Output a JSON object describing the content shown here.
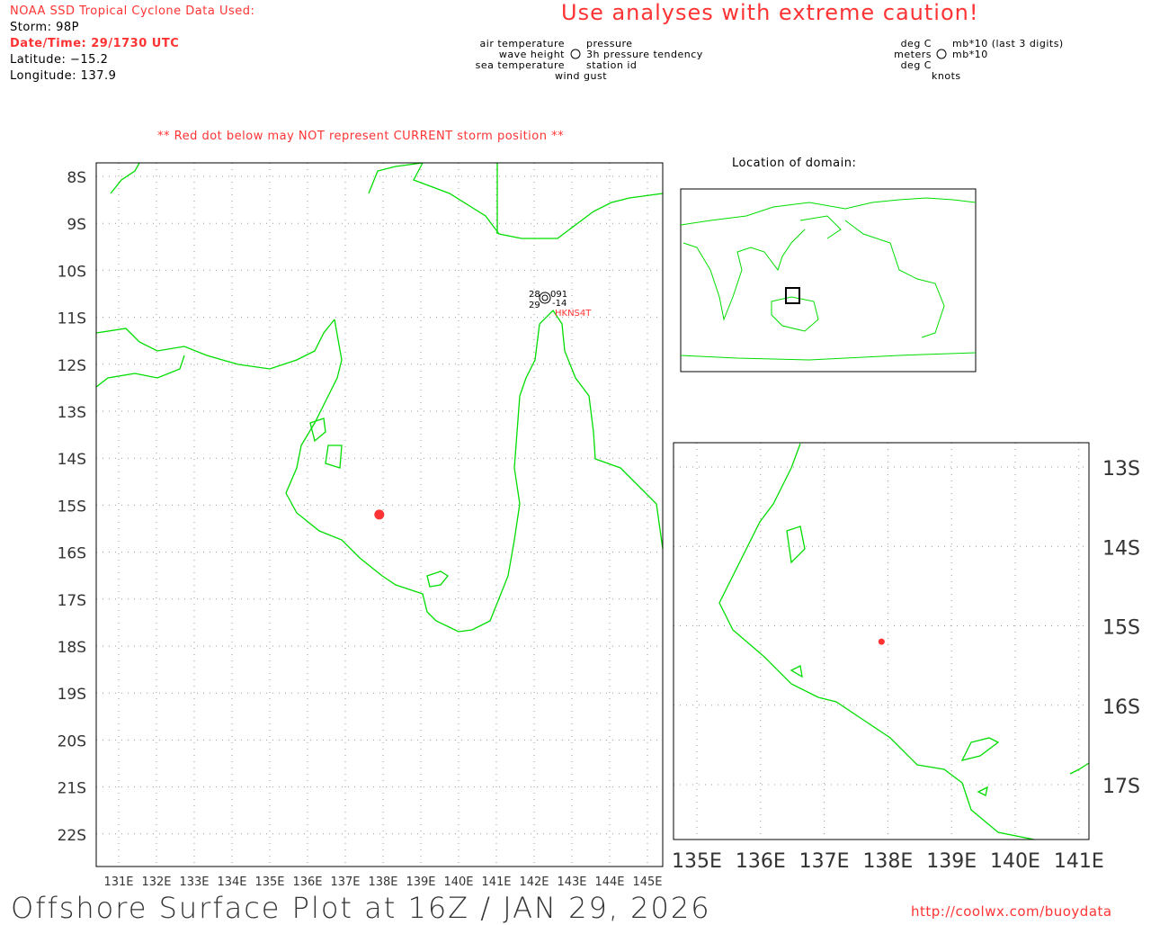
{
  "header": {
    "source_title": "NOAA SSD Tropical Cyclone Data Used:",
    "storm": "Storm: 98P",
    "datetime": "Date/Time: 29/1730 UTC",
    "latitude": "Latitude: −15.2",
    "longitude": "Longitude: 137.9",
    "caution": "Use  analyses  with  extreme  caution!",
    "warning": "** Red dot below may NOT represent CURRENT storm position **"
  },
  "legend": {
    "left": [
      "air temperature",
      "wave height",
      "sea temperature"
    ],
    "right": [
      "pressure",
      "3h pressure tendency",
      "station id"
    ],
    "bottom": "wind gust",
    "units_left": [
      "deg C",
      "meters",
      "deg C"
    ],
    "units_right": [
      "mb*10 (last 3 digits)",
      "mb*10"
    ],
    "units_bottom": "knots"
  },
  "main_map": {
    "lat_ticks": [
      "8S",
      "9S",
      "10S",
      "11S",
      "12S",
      "13S",
      "14S",
      "15S",
      "16S",
      "17S",
      "18S",
      "19S",
      "20S",
      "21S",
      "22S"
    ],
    "lon_ticks": [
      "131E",
      "132E",
      "133E",
      "134E",
      "135E",
      "136E",
      "137E",
      "138E",
      "139E",
      "140E",
      "141E",
      "142E",
      "143E",
      "144E",
      "145E"
    ],
    "storm_lat": -15.2,
    "storm_lon": 137.9,
    "station": {
      "air_temp": "28",
      "pressure": "091",
      "sea_temp": "29",
      "tendency": "-14",
      "id": "HKNS4T"
    }
  },
  "inset": {
    "title": "Location of domain:"
  },
  "zoom_map": {
    "lat_ticks": [
      "13S",
      "14S",
      "15S",
      "16S",
      "17S"
    ],
    "lon_ticks": [
      "135E",
      "136E",
      "137E",
      "138E",
      "139E",
      "140E",
      "141E"
    ]
  },
  "footer": {
    "title": "Offshore Surface Plot at 16Z / JAN 29, 2026",
    "url": "http://coolwx.com/buoydata"
  },
  "colors": {
    "coast": "#00dd00",
    "storm": "#ff3333",
    "text_red": "#ff3333"
  }
}
